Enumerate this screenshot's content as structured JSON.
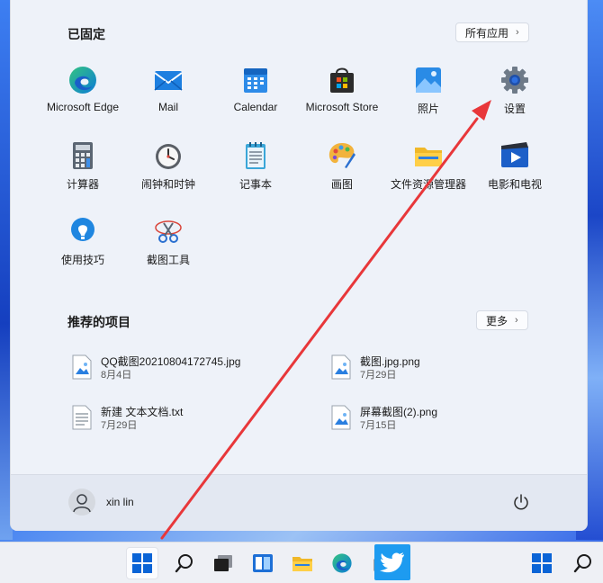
{
  "pinned": {
    "title": "已固定",
    "all_apps_label": "所有应用",
    "apps": [
      {
        "label": "Microsoft Edge"
      },
      {
        "label": "Mail"
      },
      {
        "label": "Calendar"
      },
      {
        "label": "Microsoft Store"
      },
      {
        "label": "照片"
      },
      {
        "label": "设置"
      },
      {
        "label": "计算器"
      },
      {
        "label": "闹钟和时钟"
      },
      {
        "label": "记事本"
      },
      {
        "label": "画图"
      },
      {
        "label": "文件资源管理器"
      },
      {
        "label": "电影和电视"
      },
      {
        "label": "使用技巧"
      },
      {
        "label": "截图工具"
      }
    ]
  },
  "recommended": {
    "title": "推荐的项目",
    "more_label": "更多",
    "items": [
      {
        "name": "QQ截图20210804172745.jpg",
        "date": "8月4日"
      },
      {
        "name": "截图.jpg.png",
        "date": "7月29日"
      },
      {
        "name": "新建 文本文档.txt",
        "date": "7月29日"
      },
      {
        "name": "屏幕截图(2).png",
        "date": "7月15日"
      }
    ]
  },
  "user": {
    "name": "xin lin"
  },
  "colors": {
    "annotation_arrow": "#e8373a",
    "accent": "#0a64d6"
  }
}
